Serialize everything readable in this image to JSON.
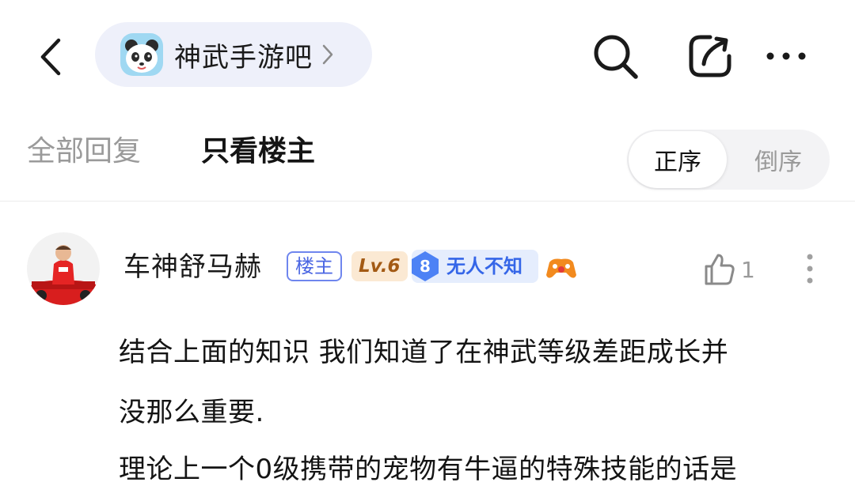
{
  "header": {
    "forum_name": "神武手游吧",
    "icons": {
      "back": "back-arrow-icon",
      "search": "search-icon",
      "share": "share-icon",
      "more": "more-horizontal-icon"
    }
  },
  "tabs": {
    "all_replies": "全部回复",
    "owner_only": "只看楼主",
    "active": "owner_only"
  },
  "sort": {
    "ascending": "正序",
    "descending": "倒序",
    "selected": "ascending"
  },
  "post": {
    "author": "车神舒马赫",
    "owner_badge": "楼主",
    "level_badge": "Lv.6",
    "title_badge": {
      "level": "8",
      "text": "无人不知"
    },
    "likes": "1",
    "paragraphs": [
      "结合上面的知识 我们知道了在神武等级差距成长并",
      "没那么重要.",
      "理论上一个0级携带的宠物有牛逼的特殊技能的话是"
    ]
  },
  "colors": {
    "accent": "#4c67e3",
    "pill_bg": "#eef0fa",
    "muted_text": "#9a9a9a"
  }
}
